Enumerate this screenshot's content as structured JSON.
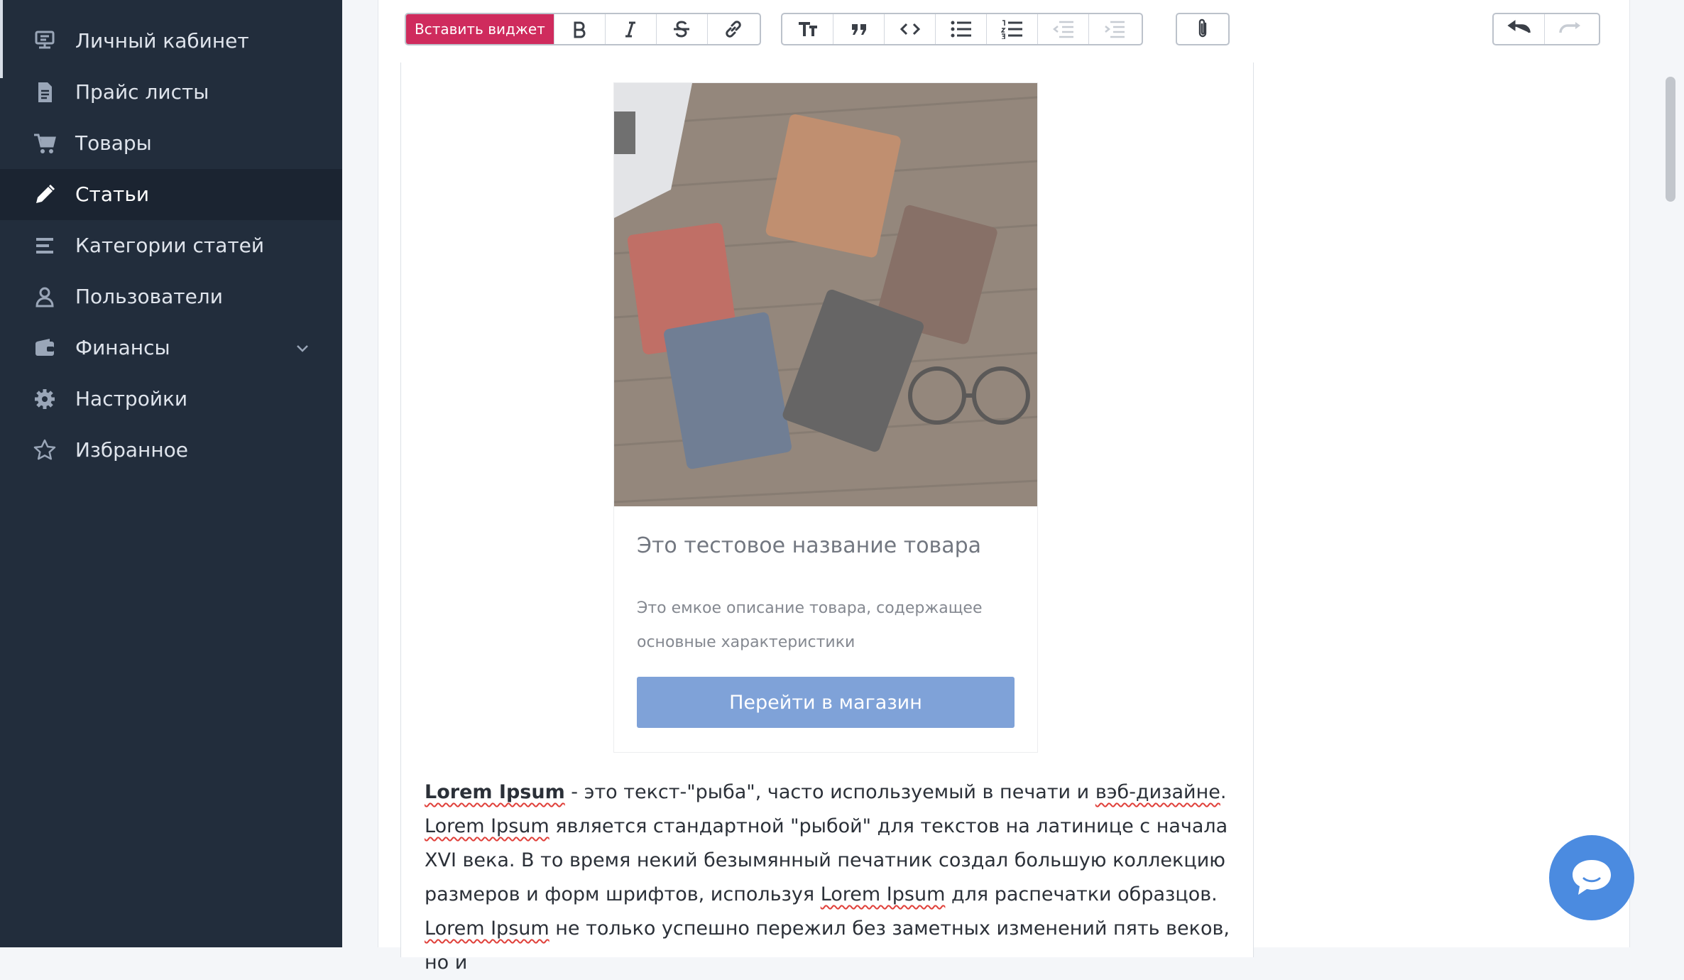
{
  "sidebar": {
    "items": [
      {
        "label": "Личный кабинет",
        "icon": "dashboard-icon"
      },
      {
        "label": "Прайс листы",
        "icon": "document-icon"
      },
      {
        "label": "Товары",
        "icon": "cart-icon"
      },
      {
        "label": "Статьи",
        "icon": "pencil-icon",
        "active": true
      },
      {
        "label": "Категории статей",
        "icon": "list-icon"
      },
      {
        "label": "Пользователи",
        "icon": "user-icon"
      },
      {
        "label": "Финансы",
        "icon": "wallet-icon",
        "expandable": true
      },
      {
        "label": "Настройки",
        "icon": "gear-icon"
      },
      {
        "label": "Избранное",
        "icon": "star-icon"
      }
    ]
  },
  "toolbar": {
    "insert_widget_label": "Вставить виджет",
    "buttons": [
      "bold-icon",
      "italic-icon",
      "strikethrough-icon",
      "link-icon",
      "heading-icon",
      "quote-icon",
      "code-icon",
      "bullet-list-icon",
      "numbered-list-icon",
      "outdent-icon",
      "indent-icon",
      "attach-icon",
      "undo-icon",
      "redo-icon"
    ]
  },
  "widget": {
    "title": "Это тестовое название товара",
    "description": "Это емкое описание товара, содержащее основные характеристики",
    "button_label": "Перейти в магазин"
  },
  "article": {
    "lead_bold": "Lorem Ipsum",
    "p1": " - это текст-\"рыба\", часто используемый в печати и ",
    "spell1": "вэб-дизайне",
    "p2": ". ",
    "spell2": "Lorem Ipsum",
    "p3": " является стандартной \"рыбой\" для текстов на латинице с начала XVI века. В то время некий безымянный печатник создал большую коллекцию размеров и форм шрифтов, используя ",
    "spell3": "Lorem Ipsum",
    "p4": " для распечатки образцов. ",
    "spell4": "Lorem Ipsum",
    "p5": " не только успешно пережил без заметных изменений пять веков, но и"
  },
  "colors": {
    "sidebar_bg": "#222d3c",
    "accent_widget": "#cf2b5d",
    "shop_button": "#4f7fca",
    "chat": "#4b8be0"
  }
}
